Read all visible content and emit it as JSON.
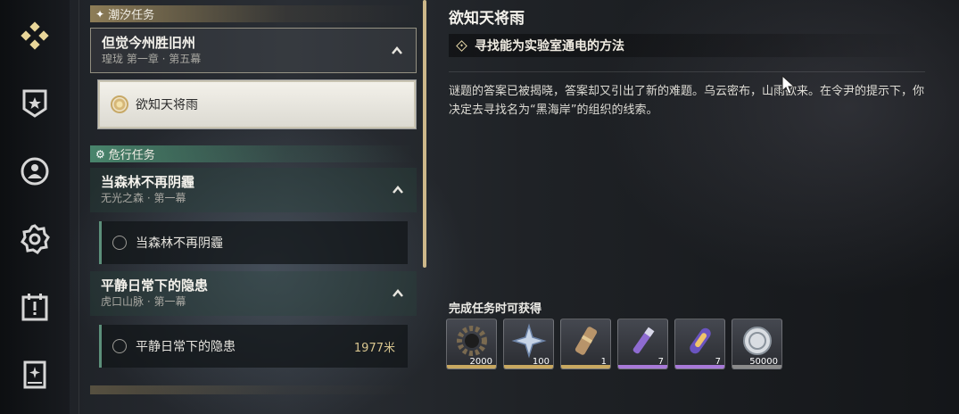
{
  "nav": {
    "items": [
      {
        "icon": "quest-diamond-icon"
      },
      {
        "icon": "shield-star-icon"
      },
      {
        "icon": "profile-icon"
      },
      {
        "icon": "settings-gear-icon"
      },
      {
        "icon": "calendar-alert-icon"
      },
      {
        "icon": "book-icon"
      }
    ]
  },
  "quests": {
    "cat_tide": "潮汐任务",
    "main_title": "但觉今州胜旧州",
    "main_sub": "瑝珑 第一章 · 第五幕",
    "main_selected_item": "欲知天将雨",
    "cat_danger": "危行任务",
    "forest_title": "当森林不再阴霾",
    "forest_sub": "无光之森 · 第一幕",
    "forest_item": "当森林不再阴霾",
    "calm_title": "平静日常下的隐患",
    "calm_sub": "虎口山脉 · 第一幕",
    "calm_item": "平静日常下的隐患",
    "calm_distance": "1977米"
  },
  "detail": {
    "title": "欲知天将雨",
    "objective": "寻找能为实验室通电的方法",
    "description": "谜题的答案已被揭晓，答案却又引出了新的难题。乌云密布，山雨欲来。在令尹的提示下，你决定去寻找名为“黑海岸”的组织的线索。",
    "reward_title": "完成任务时可获得",
    "rewards": [
      {
        "icon": "gear-ring-icon",
        "amount": "2000",
        "rarity_color": "#c8a860"
      },
      {
        "icon": "crystal-star-icon",
        "amount": "100",
        "rarity_color": "#c8a860"
      },
      {
        "icon": "scroll-tube-icon",
        "amount": "1",
        "rarity_color": "#c8a860"
      },
      {
        "icon": "purple-vial-icon",
        "amount": "7",
        "rarity_color": "#a879d8"
      },
      {
        "icon": "energy-capsule-icon",
        "amount": "7",
        "rarity_color": "#a879d8"
      },
      {
        "icon": "shell-coin-icon",
        "amount": "50000",
        "rarity_color": "#8a8a8a"
      }
    ]
  }
}
